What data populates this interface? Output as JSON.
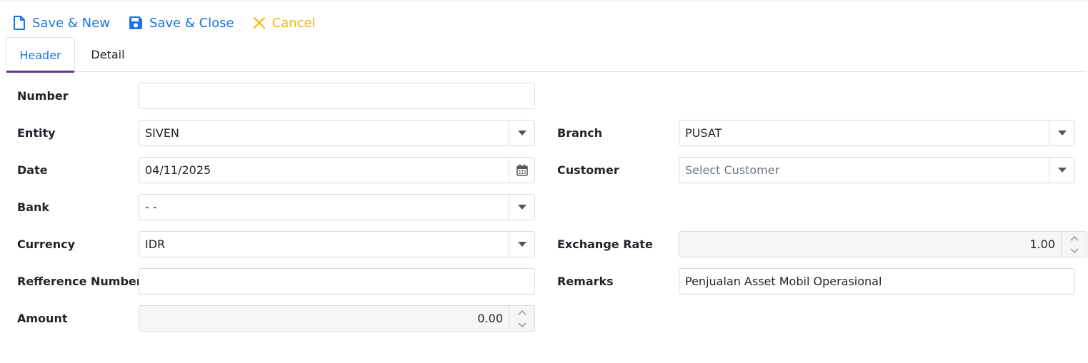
{
  "toolbar": {
    "save_new_label": "Save & New",
    "save_close_label": "Save & Close",
    "cancel_label": "Cancel"
  },
  "tabs": [
    {
      "label": "Header",
      "active": true
    },
    {
      "label": "Detail",
      "active": false
    }
  ],
  "form": {
    "number": {
      "label": "Number",
      "value": ""
    },
    "entity": {
      "label": "Entity",
      "value": "SIVEN"
    },
    "date": {
      "label": "Date",
      "value": "04/11/2025"
    },
    "bank": {
      "label": "Bank",
      "value": "- -"
    },
    "currency": {
      "label": "Currency",
      "value": "IDR"
    },
    "reference_number": {
      "label": "Refference Number",
      "value": ""
    },
    "amount": {
      "label": "Amount",
      "value": "0.00"
    },
    "branch": {
      "label": "Branch",
      "value": "PUSAT"
    },
    "customer": {
      "label": "Customer",
      "placeholder": "Select Customer"
    },
    "exchange_rate": {
      "label": "Exchange Rate",
      "value": "1.00"
    },
    "remarks": {
      "label": "Remarks",
      "value": "Penjualan Asset Mobil Operasional"
    }
  },
  "colors": {
    "primary": "#1a73e8",
    "cancel": "#f4b400",
    "tab_indicator": "#5b3a8c"
  }
}
